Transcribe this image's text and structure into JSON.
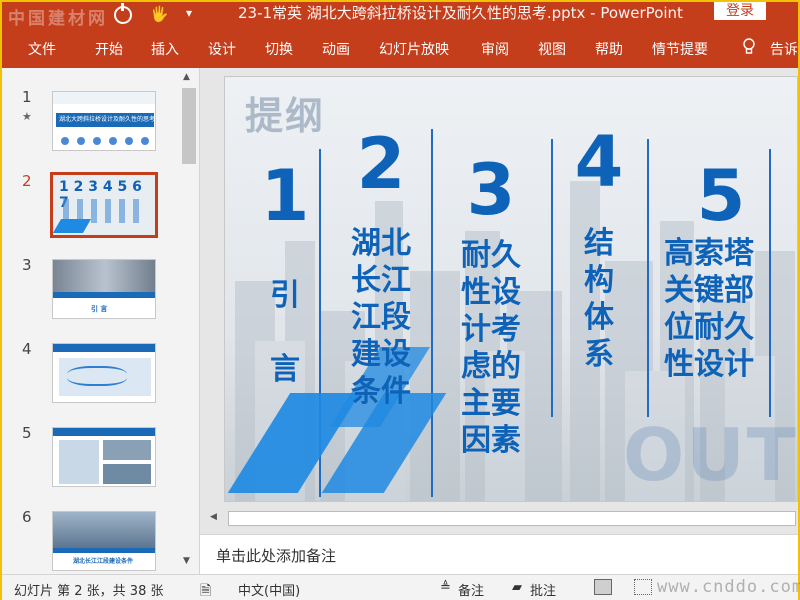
{
  "window": {
    "watermark": "中国建材网",
    "title": "23-1常英 湖北大跨斜拉桥设计及耐久性的思考.pptx - PowerPoint",
    "login_label": "登录"
  },
  "ribbon": {
    "tabs": [
      "文件",
      "开始",
      "插入",
      "设计",
      "切换",
      "动画",
      "幻灯片放映",
      "审阅",
      "视图",
      "帮助",
      "情节提要"
    ],
    "tell_me": "告诉"
  },
  "slides_panel": {
    "items": [
      {
        "num": "1",
        "star": "★",
        "title": "湖北大跨斜拉桥设计及耐久性的思考"
      },
      {
        "num": "2"
      },
      {
        "num": "3",
        "caption": "引 言"
      },
      {
        "num": "4"
      },
      {
        "num": "5"
      },
      {
        "num": "6",
        "caption": "湖北长江江段建设条件"
      }
    ],
    "active_index": 1
  },
  "slide": {
    "heading": "提纲",
    "outline_word": "OUTLI",
    "columns": [
      {
        "num": "1",
        "text": "引\n\n言"
      },
      {
        "num": "2",
        "text": "湖北\n长江\n江段\n建设\n条件"
      },
      {
        "num": "3",
        "text": "耐久\n性设\n计考\n虑的\n主要\n因素"
      },
      {
        "num": "4",
        "text": "结\n构\n体\n系"
      },
      {
        "num": "5",
        "text": "高索塔\n关键部\n位耐久\n性设计"
      }
    ]
  },
  "notes": {
    "placeholder": "单击此处添加备注"
  },
  "status": {
    "slide_info": "幻灯片 第 2 张，共 38 张",
    "language": "中文(中国)",
    "notes_label": "备注",
    "comments_label": "批注",
    "site_watermark": "www.cnddo.com"
  },
  "colors": {
    "accent": "#c43e1c",
    "slide_blue": "#0e63b8"
  }
}
